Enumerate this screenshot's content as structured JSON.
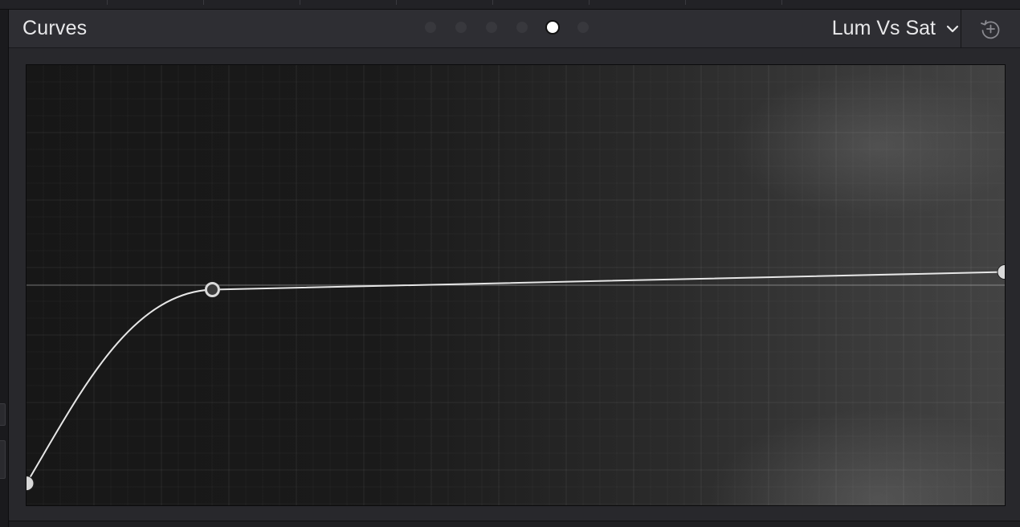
{
  "panel": {
    "title": "Curves",
    "pages": {
      "count": 6,
      "active_index": 4
    },
    "mode_selector": {
      "selected": "Lum Vs Sat",
      "icon": "chevron-down-icon"
    },
    "reset_button": {
      "icon": "reset-icon"
    }
  },
  "curve": {
    "points": [
      {
        "lum": 0.0,
        "sat": 0.05
      },
      {
        "lum": 0.19,
        "sat": 0.49
      },
      {
        "lum": 1.0,
        "sat": 0.53
      }
    ],
    "neutral_line": 0.5
  },
  "colors": {
    "curve": "#e6e6e6",
    "control_point": "#d9d9d9",
    "active_dot": "#ffffff",
    "inactive_dot": "#38383d"
  }
}
